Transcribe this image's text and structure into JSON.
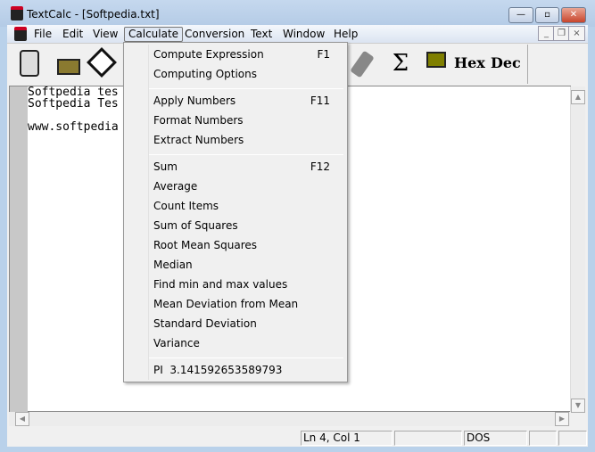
{
  "window": {
    "title": "TextCalc - [Softpedia.txt]",
    "minimize": "—",
    "maximize": "▫",
    "close": "✕"
  },
  "menubar": [
    "File",
    "Edit",
    "View",
    "Calculate",
    "Conversion",
    "Text",
    "Window",
    "Help"
  ],
  "mdi": {
    "minimize": "_",
    "restore": "❐",
    "close": "×"
  },
  "toolbar": {
    "hex": "Hex",
    "dec": "Dec",
    "sigma": "Σ"
  },
  "editor": {
    "lines": [
      "Softpedia tes",
      "Softpedia Tes",
      "",
      "www.softpedia"
    ]
  },
  "calculate_menu": {
    "groups": [
      [
        {
          "label": "Compute Expression",
          "shortcut": "F1"
        },
        {
          "label": "Computing Options",
          "shortcut": ""
        }
      ],
      [
        {
          "label": "Apply Numbers",
          "shortcut": "F11"
        },
        {
          "label": "Format Numbers",
          "shortcut": ""
        },
        {
          "label": "Extract Numbers",
          "shortcut": ""
        }
      ],
      [
        {
          "label": "Sum",
          "shortcut": "F12"
        },
        {
          "label": "Average",
          "shortcut": ""
        },
        {
          "label": "Count Items",
          "shortcut": ""
        },
        {
          "label": "Sum of Squares",
          "shortcut": ""
        },
        {
          "label": "Root Mean Squares",
          "shortcut": ""
        },
        {
          "label": "Median",
          "shortcut": ""
        },
        {
          "label": "Find min and max values",
          "shortcut": ""
        },
        {
          "label": "Mean Deviation from Mean",
          "shortcut": ""
        },
        {
          "label": "Standard Deviation",
          "shortcut": ""
        },
        {
          "label": "Variance",
          "shortcut": ""
        }
      ],
      [
        {
          "label": "PI  3.141592653589793",
          "shortcut": ""
        }
      ]
    ]
  },
  "statusbar": {
    "position": "Ln 4, Col 1",
    "panel2": "",
    "format": "DOS",
    "panel4": "",
    "panel5": ""
  }
}
